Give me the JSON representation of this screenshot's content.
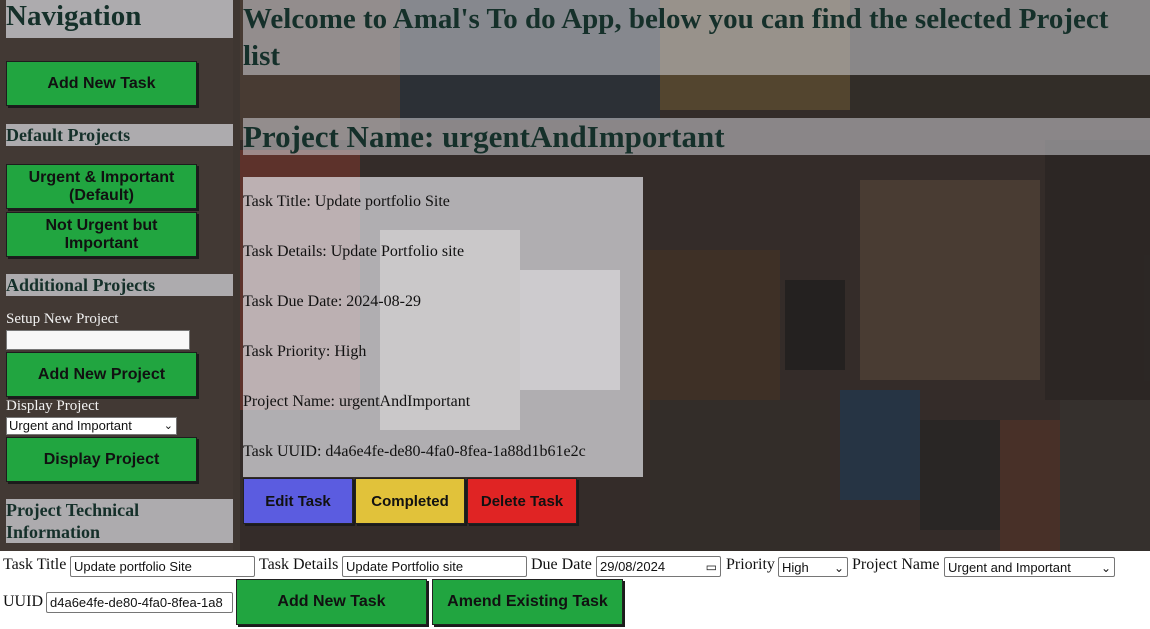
{
  "colors": {
    "green_button": "#21a540",
    "edit_button": "#5b5ce0",
    "completed_button": "#e1c23a",
    "delete_button": "#e02424",
    "heading_text": "#15302a"
  },
  "sidebar": {
    "heading": "Navigation",
    "add_task_button": "Add New Task",
    "default_projects_heading": "Default Projects",
    "default_projects": [
      "Urgent & Important (Default)",
      "Not Urgent but Important"
    ],
    "additional_projects_heading": "Additional Projects",
    "setup_label": "Setup New Project",
    "setup_value": "",
    "add_project_button": "Add New Project",
    "display_label": "Display Project",
    "display_selected": "Urgent and Important",
    "display_button": "Display Project",
    "tech_heading": "Project Technical Information"
  },
  "main": {
    "title": "Welcome to Amal's To do App, below you can find the selected Project list",
    "project_heading": "Project Name: urgentAndImportant",
    "task": {
      "title_line": "Task Title: Update portfolio Site",
      "details_line": "Task Details: Update Portfolio site",
      "due_line": "Task Due Date: 2024-08-29",
      "priority_line": "Task Priority: High",
      "project_line": "Project Name: urgentAndImportant",
      "uuid_line": "Task UUID: d4a6e4fe-de80-4fa0-8fea-1a88d1b61e2c"
    },
    "buttons": {
      "edit": "Edit Task",
      "completed": "Completed",
      "delete": "Delete Task"
    }
  },
  "form": {
    "title_label": "Task Title",
    "title_value": "Update portfolio Site",
    "details_label": "Task Details",
    "details_value": "Update Portfolio site",
    "due_label": "Due Date",
    "due_value": "29/08/2024",
    "priority_label": "Priority",
    "priority_value": "High",
    "project_label": "Project Name",
    "project_value": "Urgent and Important",
    "uuid_label": "UUID",
    "uuid_value": "d4a6e4fe-de80-4fa0-8fea-1a8",
    "add_button": "Add New Task",
    "amend_button": "Amend Existing Task"
  }
}
